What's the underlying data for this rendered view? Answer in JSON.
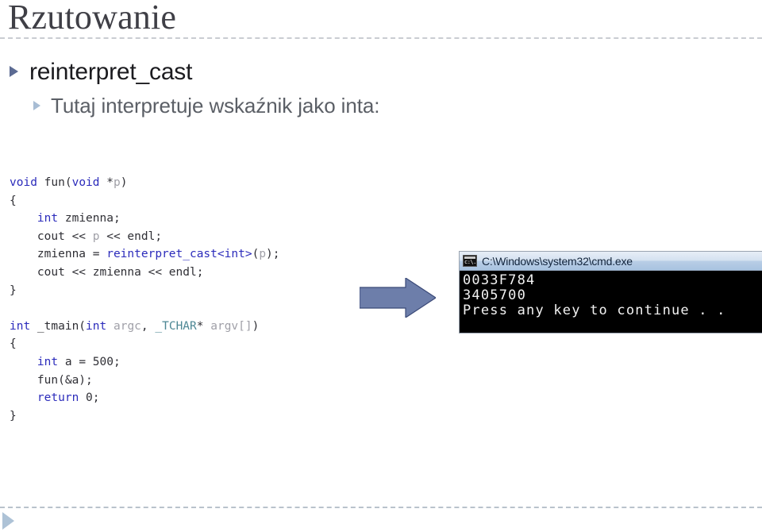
{
  "slide": {
    "title": "Rzutowanie",
    "bullets": [
      {
        "level": 1,
        "text": "reinterpret_cast"
      },
      {
        "level": 2,
        "text": "Tutaj interpretuje wskaźnik jako inta:"
      }
    ]
  },
  "code": {
    "language": "cpp",
    "lines": [
      {
        "tokens": [
          {
            "t": "void",
            "c": "kw"
          },
          {
            "t": " ",
            "c": "plain"
          },
          {
            "t": "fun",
            "c": "fn"
          },
          {
            "t": "(",
            "c": "plain"
          },
          {
            "t": "void",
            "c": "kw"
          },
          {
            "t": " *",
            "c": "plain"
          },
          {
            "t": "p",
            "c": "dim"
          },
          {
            "t": ")",
            "c": "plain"
          }
        ]
      },
      {
        "tokens": [
          {
            "t": "{",
            "c": "plain"
          }
        ]
      },
      {
        "tokens": [
          {
            "t": "    ",
            "c": "plain"
          },
          {
            "t": "int",
            "c": "kw"
          },
          {
            "t": " zmienna;",
            "c": "plain"
          }
        ]
      },
      {
        "tokens": [
          {
            "t": "    cout << ",
            "c": "plain"
          },
          {
            "t": "p",
            "c": "dim"
          },
          {
            "t": " << endl;",
            "c": "plain"
          }
        ]
      },
      {
        "tokens": [
          {
            "t": "    zmienna = ",
            "c": "plain"
          },
          {
            "t": "reinterpret_cast",
            "c": "kw"
          },
          {
            "t": "<",
            "c": "kw"
          },
          {
            "t": "int",
            "c": "kw"
          },
          {
            "t": ">",
            "c": "kw"
          },
          {
            "t": "(",
            "c": "plain"
          },
          {
            "t": "p",
            "c": "dim"
          },
          {
            "t": ");",
            "c": "plain"
          }
        ]
      },
      {
        "tokens": [
          {
            "t": "    cout << zmienna << endl;",
            "c": "plain"
          }
        ]
      },
      {
        "tokens": [
          {
            "t": "}",
            "c": "plain"
          }
        ]
      },
      {
        "tokens": [
          {
            "t": "",
            "c": "plain"
          }
        ]
      },
      {
        "tokens": [
          {
            "t": "int",
            "c": "kw"
          },
          {
            "t": " _tmain(",
            "c": "plain"
          },
          {
            "t": "int",
            "c": "kw"
          },
          {
            "t": " ",
            "c": "plain"
          },
          {
            "t": "argc",
            "c": "dim"
          },
          {
            "t": ", ",
            "c": "plain"
          },
          {
            "t": "_TCHAR",
            "c": "tchar"
          },
          {
            "t": "* ",
            "c": "plain"
          },
          {
            "t": "argv[]",
            "c": "dim"
          },
          {
            "t": ")",
            "c": "plain"
          }
        ]
      },
      {
        "tokens": [
          {
            "t": "{",
            "c": "plain"
          }
        ]
      },
      {
        "tokens": [
          {
            "t": "    ",
            "c": "plain"
          },
          {
            "t": "int",
            "c": "kw"
          },
          {
            "t": " a = ",
            "c": "plain"
          },
          {
            "t": "500",
            "c": "num"
          },
          {
            "t": ";",
            "c": "plain"
          }
        ]
      },
      {
        "tokens": [
          {
            "t": "    fun(&a);",
            "c": "plain"
          }
        ]
      },
      {
        "tokens": [
          {
            "t": "    ",
            "c": "plain"
          },
          {
            "t": "return",
            "c": "kw"
          },
          {
            "t": " ",
            "c": "plain"
          },
          {
            "t": "0",
            "c": "num"
          },
          {
            "t": ";",
            "c": "plain"
          }
        ]
      },
      {
        "tokens": [
          {
            "t": "}",
            "c": "plain"
          }
        ]
      }
    ]
  },
  "arrow": {
    "label": "right-arrow",
    "fill": "#6d7eaa",
    "stroke": "#3b4a78"
  },
  "console": {
    "title": "C:\\Windows\\system32\\cmd.exe",
    "icon": "cmd-icon",
    "output": "0033F784\n3405700\nPress any key to continue . ."
  },
  "nav": {
    "next_label": "next-slide"
  },
  "colors": {
    "title": "#3f3f46",
    "bullet_level1": "#1b1b1f",
    "bullet_level2": "#5b5f66",
    "keyword": "#2b2bbb",
    "dim": "#a0a0a8",
    "tchar": "#4d8794",
    "rule": "#c9ccd2",
    "arrow": "#6d7eaa",
    "console_bg": "#000000",
    "console_text": "#f2f2f2"
  }
}
